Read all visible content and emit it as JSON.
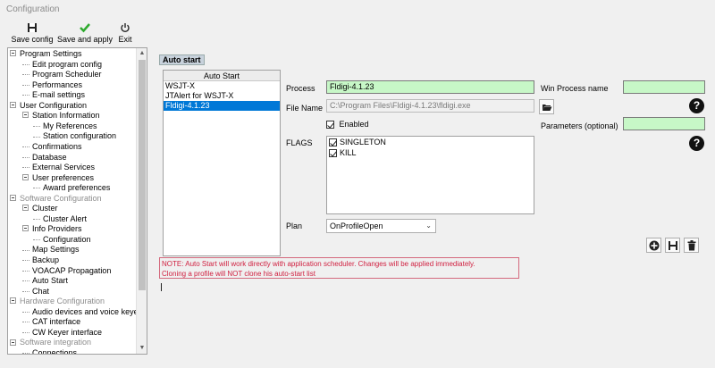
{
  "window": {
    "title": "Configuration"
  },
  "toolbar": {
    "save_config": "Save config",
    "save_apply": "Save and apply",
    "exit": "Exit"
  },
  "tree": [
    {
      "label": "Program Settings",
      "level": 0,
      "expandable": true,
      "gray": false
    },
    {
      "label": "Edit program config",
      "level": 1
    },
    {
      "label": "Program Scheduler",
      "level": 1
    },
    {
      "label": "Performances",
      "level": 1
    },
    {
      "label": "E-mail settings",
      "level": 1
    },
    {
      "label": "User Configuration",
      "level": 0,
      "expandable": true,
      "gray": false
    },
    {
      "label": "Station Information",
      "level": 1,
      "expandable": true
    },
    {
      "label": "My References",
      "level": 2
    },
    {
      "label": "Station configuration",
      "level": 2
    },
    {
      "label": "Confirmations",
      "level": 1
    },
    {
      "label": "Database",
      "level": 1
    },
    {
      "label": "External Services",
      "level": 1
    },
    {
      "label": "User preferences",
      "level": 1,
      "expandable": true
    },
    {
      "label": "Award preferences",
      "level": 2
    },
    {
      "label": "Software Configuration",
      "level": 0,
      "expandable": true,
      "gray": true
    },
    {
      "label": "Cluster",
      "level": 1,
      "expandable": true
    },
    {
      "label": "Cluster Alert",
      "level": 2
    },
    {
      "label": "Info Providers",
      "level": 1,
      "expandable": true
    },
    {
      "label": "Configuration",
      "level": 2
    },
    {
      "label": "Map Settings",
      "level": 1
    },
    {
      "label": "Backup",
      "level": 1
    },
    {
      "label": "VOACAP Propagation",
      "level": 1
    },
    {
      "label": "Auto Start",
      "level": 1
    },
    {
      "label": "Chat",
      "level": 1
    },
    {
      "label": "Hardware Configuration",
      "level": 0,
      "expandable": true,
      "gray": true
    },
    {
      "label": "Audio devices and voice keye",
      "level": 1
    },
    {
      "label": "CAT interface",
      "level": 1
    },
    {
      "label": "CW Keyer interface",
      "level": 1
    },
    {
      "label": "Software integration",
      "level": 0,
      "expandable": true,
      "gray": true
    },
    {
      "label": "Connections",
      "level": 1
    }
  ],
  "section": {
    "title": "Auto start"
  },
  "autostart_list": {
    "header": "Auto Start",
    "items": [
      "WSJT-X",
      "JTAlert for WSJT-X",
      "Fldigi-4.1.23"
    ],
    "selected_index": 2
  },
  "form": {
    "process_label": "Process",
    "process_value": "Fldigi-4.1.23",
    "filename_label": "File Name",
    "filename_value": "C:\\Program Files\\Fldigi-4.1.23\\fldigi.exe",
    "enabled_label": "Enabled",
    "enabled": true,
    "flags_label": "FLAGS",
    "flags": [
      {
        "label": "SINGLETON",
        "checked": true
      },
      {
        "label": "KILL",
        "checked": true
      }
    ],
    "plan_label": "Plan",
    "plan_value": "OnProfileOpen",
    "win_process_label": "Win Process name",
    "win_process_value": "",
    "parameters_label": "Parameters (optional)",
    "parameters_value": ""
  },
  "note": {
    "line1": "NOTE: Auto Start will work directly with application scheduler. Changes will be applied immediately.",
    "line2": "Cloning a profile will NOT clone his auto-start list"
  },
  "colors": {
    "input_green": "#c7f7c7",
    "selection_blue": "#0078d7",
    "note_red": "#d02040"
  }
}
